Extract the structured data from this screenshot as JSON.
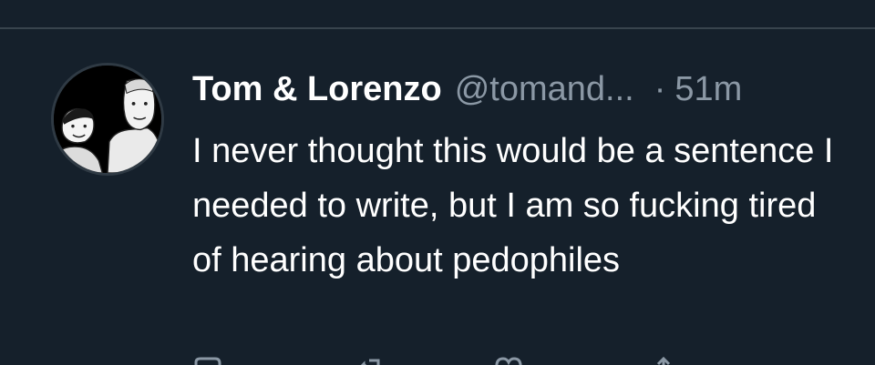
{
  "tweet": {
    "display_name": "Tom & Lorenzo",
    "handle": "@tomand...",
    "separator": "·",
    "timestamp": "51m",
    "text": "I never thought this would be a sentence I needed to write, but I am so fucking tired of hearing about pedophiles"
  },
  "colors": {
    "background": "#15202b",
    "divider": "#38444d",
    "secondary_text": "#8b98a5",
    "primary_text": "#ffffff"
  },
  "icons": {
    "avatar": "two-men-cartoon-avatar",
    "actions": [
      "reply-icon",
      "retweet-icon",
      "like-icon",
      "share-icon"
    ]
  }
}
